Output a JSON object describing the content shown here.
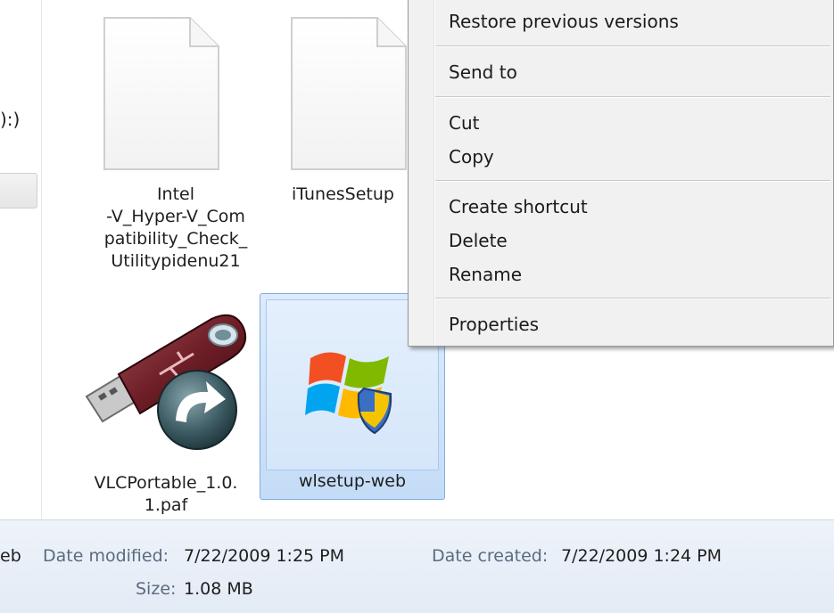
{
  "nav": {
    "drive_label": "):)",
    "drive_label_visible": "):)"
  },
  "files": [
    {
      "name_lines": [
        "Intel",
        "-V_Hyper-V_Com",
        "patibility_Check_",
        "Utilitypidenu21"
      ],
      "icon": "document-icon"
    },
    {
      "name_lines": [
        "iTunesSetup"
      ],
      "icon": "document-icon"
    },
    {
      "name_lines": [
        "VLCPortable_1.0.",
        "1.paf"
      ],
      "icon": "usb-drive-icon"
    },
    {
      "name_lines": [
        "wlsetup-web"
      ],
      "icon": "windows-installer-icon",
      "selected": true
    }
  ],
  "context_menu": {
    "items": [
      {
        "label": "Restore previous versions"
      },
      {
        "label": "Send to"
      },
      {
        "label": "Cut"
      },
      {
        "label": "Copy"
      },
      {
        "label": "Create shortcut"
      },
      {
        "label": "Delete"
      },
      {
        "label": "Rename"
      },
      {
        "label": "Properties"
      }
    ]
  },
  "details": {
    "name_fragment": "eb",
    "date_modified_label": "Date modified:",
    "date_modified_value": "7/22/2009 1:25 PM",
    "date_created_label": "Date created:",
    "date_created_value": "7/22/2009 1:24 PM",
    "size_label": "Size:",
    "size_value": "1.08 MB"
  },
  "colors": {
    "selection_fill": "#c4dcf7",
    "selection_border": "#84acdd",
    "menu_background": "#f1f1f1",
    "details_background": "#e3ebf5"
  }
}
